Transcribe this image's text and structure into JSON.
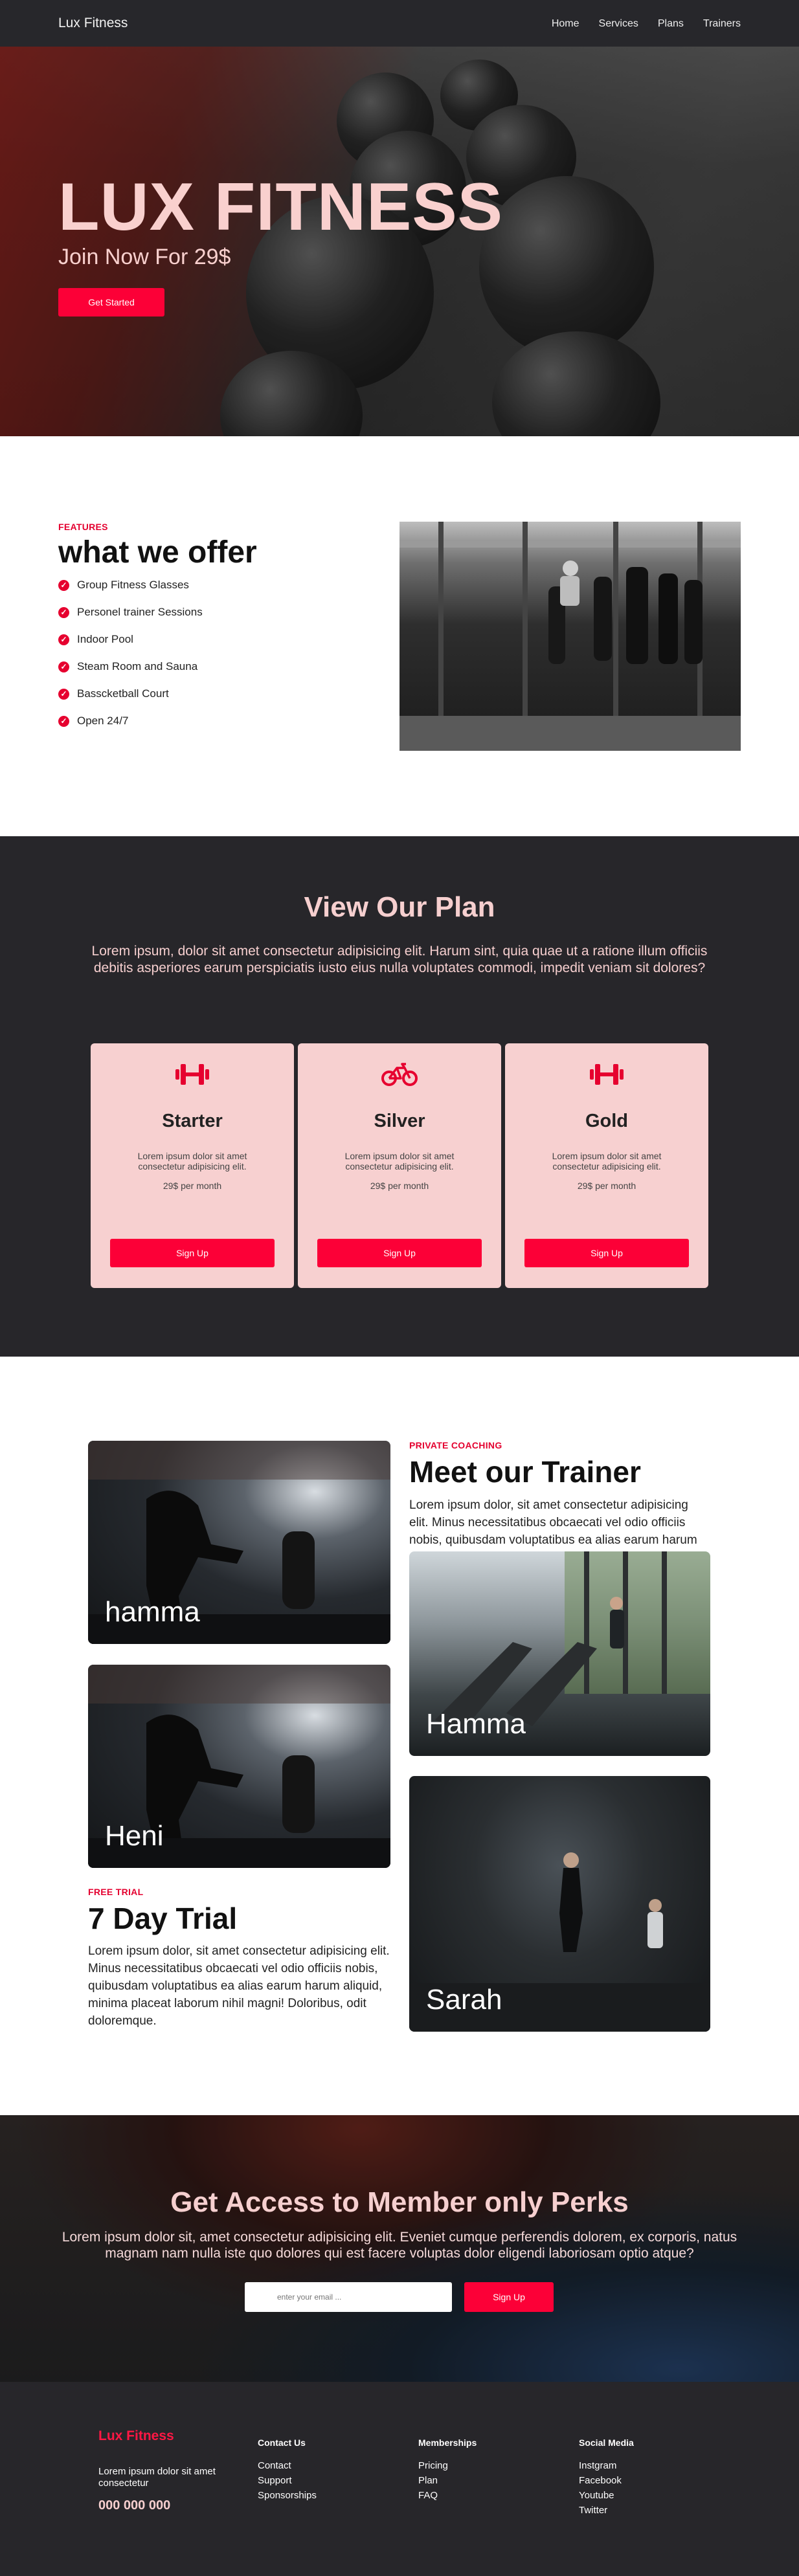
{
  "nav": {
    "brand": "Lux Fitness",
    "links": [
      "Home",
      "Services",
      "Plans",
      "Trainers"
    ]
  },
  "hero": {
    "title": "LUX FITNESS",
    "subtitle": "Join Now For 29$",
    "cta": "Get Started"
  },
  "features": {
    "eyebrow": "FEATURES",
    "title": "what we offer",
    "items": [
      "Group Fitness Glasses",
      "Personel trainer Sessions",
      "Indoor Pool",
      "Steam Room and Sauna",
      "Basscketball Court",
      "Open 24/7"
    ]
  },
  "plans": {
    "title": "View Our Plan",
    "description": "Lorem ipsum, dolor sit amet consectetur adipisicing elit. Harum sint, quia quae ut a ratione illum officiis debitis asperiores earum perspiciatis iusto eius nulla voluptates commodi, impedit veniam sit dolores?",
    "cards": [
      {
        "name": "Starter",
        "icon": "dumbbell-icon",
        "desc": "Lorem ipsum dolor sit amet consectetur adipisicing elit.",
        "price": "29$ per month",
        "button": "Sign Up"
      },
      {
        "name": "Silver",
        "icon": "bicycle-icon",
        "desc": "Lorem ipsum dolor sit amet consectetur adipisicing elit.",
        "price": "29$ per month",
        "button": "Sign Up"
      },
      {
        "name": "Gold",
        "icon": "dumbbell-icon",
        "desc": "Lorem ipsum dolor sit amet consectetur adipisicing elit.",
        "price": "29$ per month",
        "button": "Sign Up"
      }
    ]
  },
  "trainers": {
    "eyebrow": "PRIVATE COACHING",
    "title": "Meet our Trainer",
    "description": "Lorem ipsum dolor, sit amet consectetur adipisicing elit. Minus necessitatibus obcaecati vel odio officiis nobis, quibusdam voluptatibus ea alias earum harum",
    "names": [
      "hamma",
      "Heni",
      "Hamma",
      "Sarah"
    ]
  },
  "trial": {
    "eyebrow": "FREE TRIAL",
    "title": "7 Day Trial",
    "description": "Lorem ipsum dolor, sit amet consectetur adipisicing elit. Minus necessitatibus obcaecati vel odio officiis nobis, quibusdam voluptatibus ea alias earum harum aliquid, minima placeat laborum nihil magni! Doloribus, odit doloremque."
  },
  "perks": {
    "title": "Get Access to Member only Perks",
    "description": "Lorem ipsum dolor sit, amet consectetur adipisicing elit. Eveniet cumque perferendis dolorem, ex corporis, natus magnam nam nulla iste quo dolores qui est facere voluptas dolor eligendi laboriosam optio atque?",
    "email_placeholder": "enter your email ...",
    "button": "Sign Up"
  },
  "footer": {
    "brand": "Lux Fitness",
    "about": "Lorem ipsum dolor sit amet consectetur",
    "phone": "000 000 000",
    "columns": [
      {
        "title": "Contact Us",
        "links": [
          "Contact",
          "Support",
          "Sponsorships"
        ]
      },
      {
        "title": "Memberships",
        "links": [
          "Pricing",
          "Plan",
          "FAQ"
        ]
      },
      {
        "title": "Social Media",
        "links": [
          "Instgram",
          "Facebook",
          "Youtube",
          "Twitter"
        ]
      }
    ]
  },
  "colors": {
    "accent": "#fc0037",
    "dark": "#27262a",
    "pink": "#f7d0d0"
  }
}
